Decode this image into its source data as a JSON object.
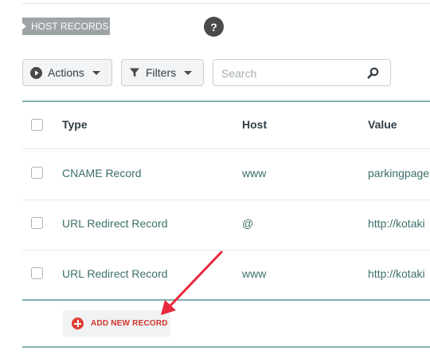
{
  "section": {
    "title": "HOST RECORDS",
    "help_icon": "?"
  },
  "toolbar": {
    "actions_label": "Actions",
    "filters_label": "Filters",
    "search_placeholder": "Search"
  },
  "table": {
    "headers": {
      "type": "Type",
      "host": "Host",
      "value": "Value"
    },
    "rows": [
      {
        "type": "CNAME Record",
        "host": "www",
        "value": "parkingpage"
      },
      {
        "type": "URL Redirect Record",
        "host": "@",
        "value": "http://kotaki"
      },
      {
        "type": "URL Redirect Record",
        "host": "www",
        "value": "http://kotaki"
      }
    ]
  },
  "add_record": {
    "label": "ADD NEW RECORD"
  },
  "colors": {
    "accent_teal": "#7fb3ae",
    "link_teal": "#3b6f6b",
    "add_red": "#e03d35",
    "annotation_arrow": "#e8293c"
  },
  "icons": [
    "play-circle-icon",
    "filter-icon",
    "chevron-down-icon",
    "search-icon",
    "plus-circle-icon",
    "help-icon"
  ]
}
